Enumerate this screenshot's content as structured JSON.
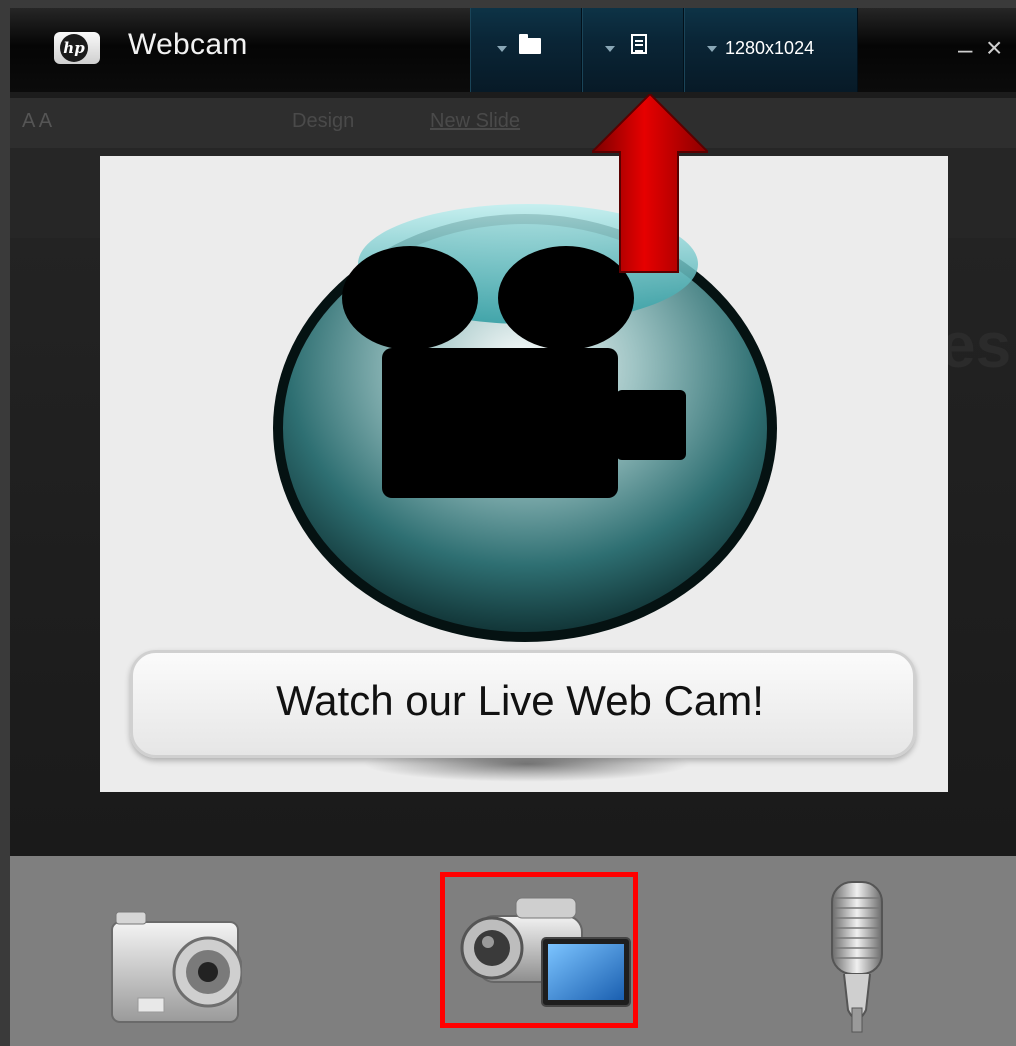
{
  "app": {
    "title": "Webcam",
    "logo_text": "hp"
  },
  "toolbar": {
    "folder_button_icon": "folder-icon",
    "document_button_icon": "document-icon",
    "resolution_label": "1280x1024"
  },
  "window_controls": {
    "minimize": "–",
    "close": "×"
  },
  "background_app": {
    "design_label": "Design",
    "new_slide_label": "New Slide"
  },
  "preview": {
    "caption": "Watch our Live Web Cam!"
  },
  "modes": [
    {
      "name": "photo",
      "icon": "still-camera-icon",
      "selected": false
    },
    {
      "name": "video",
      "icon": "video-camera-icon",
      "selected": true
    },
    {
      "name": "audio",
      "icon": "microphone-icon",
      "selected": false
    }
  ],
  "colors": {
    "toolbar_blue": "#0a2536",
    "highlight_red": "#ff0000",
    "arrow_red": "#cc0000",
    "bottom_bar": "#7f7f7f"
  }
}
